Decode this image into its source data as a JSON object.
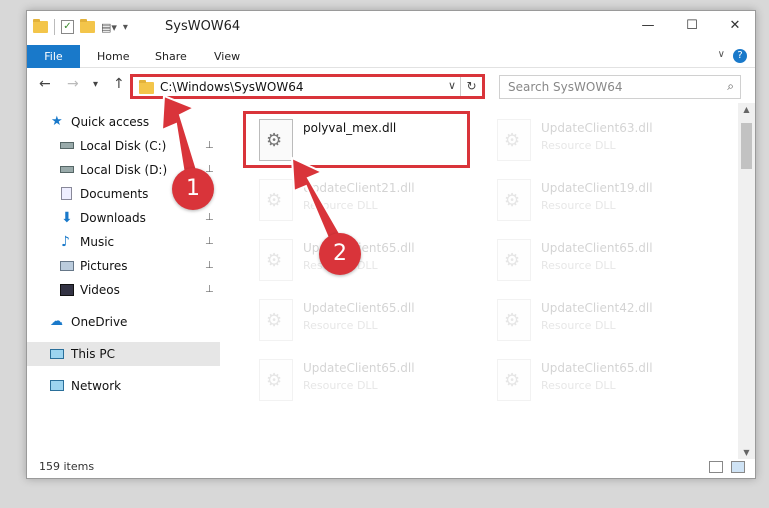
{
  "window": {
    "title": "SysWOW64",
    "minimize_glyph": "—",
    "maximize_glyph": "☐",
    "close_glyph": "✕"
  },
  "ribbon": {
    "tabs": [
      "File",
      "Home",
      "Share",
      "View"
    ],
    "help_glyph": "?",
    "collapse_glyph": "∨"
  },
  "nav": {
    "back_glyph": "←",
    "forward_glyph": "→",
    "recent_glyph": "▾",
    "up_glyph": "↑",
    "address": "C:\\Windows\\SysWOW64",
    "address_dropdown_glyph": "∨",
    "refresh_glyph": "↻",
    "search_placeholder": "Search SysWOW64",
    "search_glyph": "⌕"
  },
  "sidebar": {
    "items": [
      {
        "label": "Quick access",
        "icon": "star-icon"
      },
      {
        "label": "Local Disk (C:)",
        "icon": "drive-icon",
        "pinned": true
      },
      {
        "label": "Local Disk (D:)",
        "icon": "drive-icon",
        "pinned": true
      },
      {
        "label": "Documents",
        "icon": "documents-icon",
        "pinned": true
      },
      {
        "label": "Downloads",
        "icon": "downloads-icon",
        "pinned": true
      },
      {
        "label": "Music",
        "icon": "music-icon",
        "pinned": true
      },
      {
        "label": "Pictures",
        "icon": "pictures-icon",
        "pinned": true
      },
      {
        "label": "Videos",
        "icon": "videos-icon",
        "pinned": true
      },
      {
        "label": "OneDrive",
        "icon": "onedrive-icon"
      },
      {
        "label": "This PC",
        "icon": "computer-icon",
        "selected": true
      },
      {
        "label": "Network",
        "icon": "network-icon"
      }
    ],
    "pin_glyph": "📌"
  },
  "files": [
    {
      "name": "polyval_mex.dll",
      "type": ""
    },
    {
      "name": "UpdateClient63.dll",
      "type": "Resource DLL"
    },
    {
      "name": "UpdateClient21.dll",
      "type": "Resource DLL"
    },
    {
      "name": "UpdateClient19.dll",
      "type": "Resource DLL"
    },
    {
      "name": "UpdateClient65.dll",
      "type": "Resource DLL"
    },
    {
      "name": "UpdateClient65.dll",
      "type": "Resource DLL"
    },
    {
      "name": "UpdateClient65.dll",
      "type": "Resource DLL"
    },
    {
      "name": "UpdateClient42.dll",
      "type": "Resource DLL"
    },
    {
      "name": "UpdateClient65.dll",
      "type": "Resource DLL"
    },
    {
      "name": "UpdateClient65.dll",
      "type": "Resource DLL"
    }
  ],
  "status": {
    "item_count": "159 items"
  },
  "callouts": [
    "1",
    "2"
  ],
  "colors": {
    "accent": "#1979ca",
    "highlight": "#d9343a"
  }
}
